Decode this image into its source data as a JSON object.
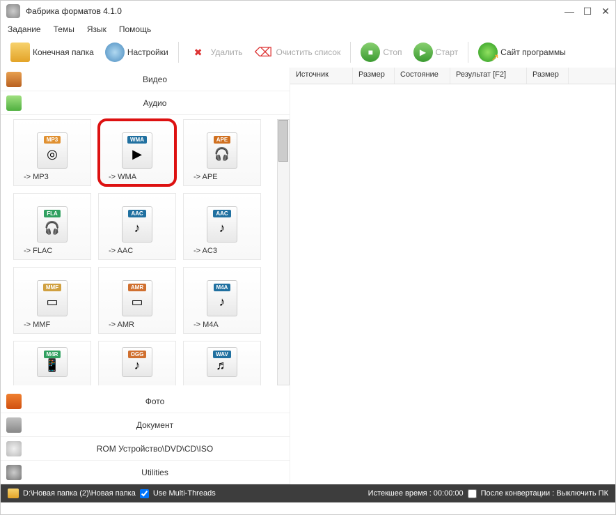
{
  "title": "Фабрика форматов 4.1.0",
  "menu": [
    "Задание",
    "Темы",
    "Язык",
    "Помощь"
  ],
  "toolbar": {
    "output_folder": "Конечная папка",
    "settings": "Настройки",
    "delete": "Удалить",
    "clear": "Очистить список",
    "stop": "Стоп",
    "start": "Старт",
    "site": "Сайт программы"
  },
  "categories": {
    "video": "Видео",
    "audio": "Аудио",
    "photo": "Фото",
    "document": "Документ",
    "rom": "ROM Устройство\\DVD\\CD\\ISO",
    "utilities": "Utilities"
  },
  "formats": [
    {
      "badge": "MP3",
      "badge_color": "#e09030",
      "symbol": "◎",
      "label": "-> MP3"
    },
    {
      "badge": "WMA",
      "badge_color": "#2070a0",
      "symbol": "▶",
      "label": "-> WMA",
      "highlighted": true
    },
    {
      "badge": "APE",
      "badge_color": "#d07020",
      "symbol": "🎧",
      "label": "-> APE"
    },
    {
      "badge": "FLA",
      "badge_color": "#30a060",
      "symbol": "🎧",
      "label": "-> FLAC"
    },
    {
      "badge": "AAC",
      "badge_color": "#2070a0",
      "symbol": "♪",
      "label": "-> AAC"
    },
    {
      "badge": "AAC",
      "badge_color": "#2070a0",
      "symbol": "♪",
      "label": "-> AC3"
    },
    {
      "badge": "MMF",
      "badge_color": "#d0a040",
      "symbol": "▭",
      "label": "-> MMF"
    },
    {
      "badge": "AMR",
      "badge_color": "#d07030",
      "symbol": "▭",
      "label": "-> AMR"
    },
    {
      "badge": "M4A",
      "badge_color": "#2070a0",
      "symbol": "♪",
      "label": "-> M4A"
    },
    {
      "badge": "M4R",
      "badge_color": "#30a060",
      "symbol": "📱",
      "label": ""
    },
    {
      "badge": "OGG",
      "badge_color": "#d07030",
      "symbol": "♪",
      "label": ""
    },
    {
      "badge": "WAV",
      "badge_color": "#2070a0",
      "symbol": "♬",
      "label": ""
    }
  ],
  "table_headers": [
    "Источник",
    "Размер",
    "Состояние",
    "Результат [F2]",
    "Размер"
  ],
  "statusbar": {
    "path": "D:\\Новая папка (2)\\Новая папка",
    "multithreads": "Use Multi-Threads",
    "elapsed": "Истекшее время : 00:00:00",
    "after": "После конвертации : Выключить ПК"
  }
}
